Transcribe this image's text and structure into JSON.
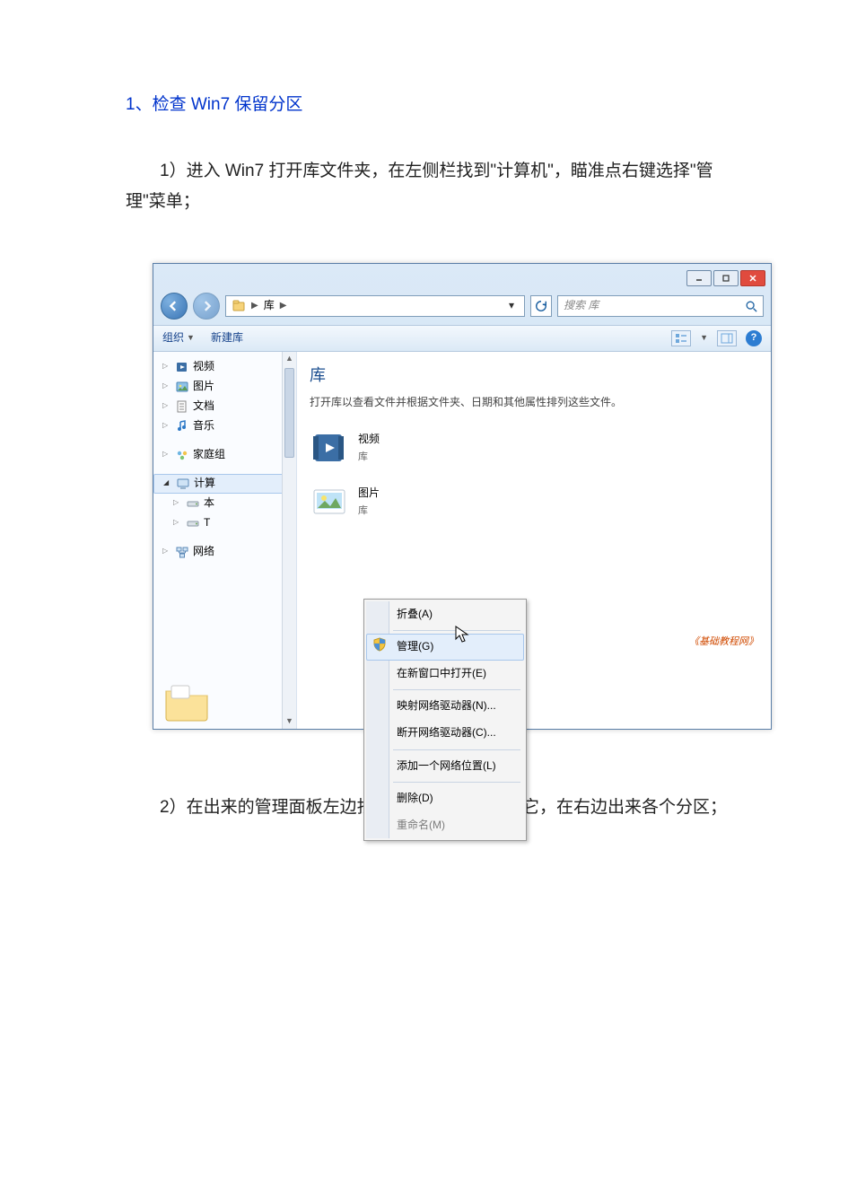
{
  "doc": {
    "section_title": "1、检查 Win7 保留分区",
    "para1": "1）进入 Win7 打开库文件夹，在左侧栏找到\"计算机\"，瞄准点右键选择\"管理\"菜单；",
    "para2": "2）在出来的管理面板左边找到\"磁盘管理\"，点击它，在右边出来各个分区；"
  },
  "win": {
    "breadcrumb_root": "库",
    "search_placeholder": "搜索 库",
    "toolbar": {
      "organize": "组织",
      "newlib": "新建库"
    },
    "nav": {
      "video": "视频",
      "pictures": "图片",
      "documents": "文档",
      "music": "音乐",
      "homegroup": "家庭组",
      "computer": "计算",
      "localdisk": "本",
      "localdisk2": "T",
      "network": "网络"
    },
    "content": {
      "title": "库",
      "subtitle": "打开库以查看文件并根据文件夹、日期和其他属性排列这些文件。",
      "items": [
        {
          "name": "视频",
          "kind": "库"
        },
        {
          "name": "图片",
          "kind": "库"
        }
      ],
      "watermark": "《基础教程网》"
    },
    "ctx": {
      "collapse": "折叠(A)",
      "manage": "管理(G)",
      "open_new_win": "在新窗口中打开(E)",
      "map_drive": "映射网络驱动器(N)...",
      "disconnect_drive": "断开网络驱动器(C)...",
      "add_net_loc": "添加一个网络位置(L)",
      "delete": "删除(D)",
      "rename": "重命名(M)"
    }
  }
}
